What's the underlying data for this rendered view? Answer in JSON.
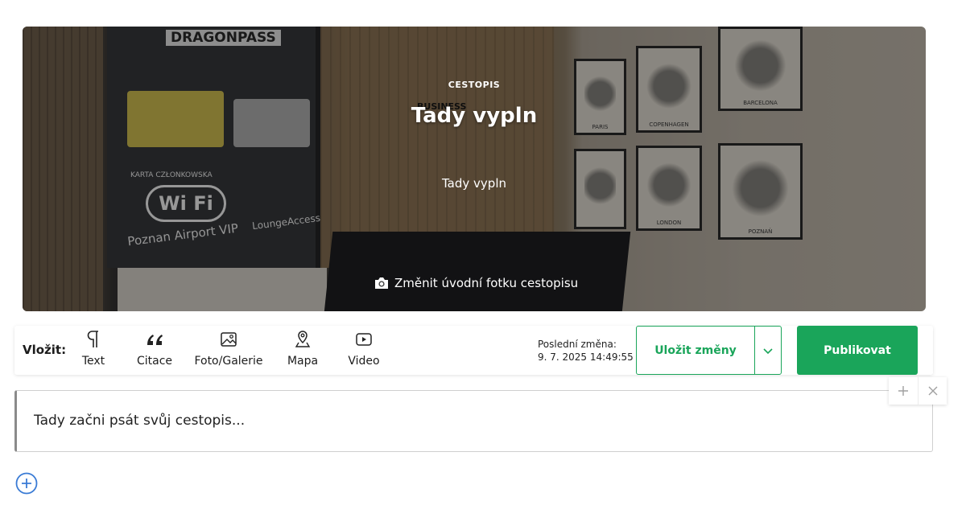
{
  "hero": {
    "label": "CESTOPIS",
    "title": "Tady vypln",
    "subtitle": "Tady vypln",
    "change_photo": "Změnit úvodní fotku cestopisu",
    "photo": {
      "signs": [
        "DRAGONPASS",
        "BUSINESS",
        "Poznan Airport VIP",
        "LoungeAccess",
        "Wi Fi",
        "KARTA CZŁONKOWSKA"
      ],
      "frames": [
        "PARIS",
        "COPENHAGEN",
        "BARCELONA",
        "LONDON",
        "POZNAŃ"
      ]
    }
  },
  "toolbar": {
    "insert_label": "Vložit:",
    "tools": [
      {
        "label": "Text",
        "icon": "pilcrow-icon"
      },
      {
        "label": "Citace",
        "icon": "quote-icon"
      },
      {
        "label": "Foto/Galerie",
        "icon": "image-icon"
      },
      {
        "label": "Mapa",
        "icon": "map-pin-icon"
      },
      {
        "label": "Video",
        "icon": "video-play-icon"
      }
    ],
    "last_change_label": "Poslední změna:",
    "last_change_value": "9. 7. 2025 14:49:55",
    "save_label": "Uložit změny",
    "publish_label": "Publikovat"
  },
  "editor": {
    "placeholder": "Tady začni psát svůj cestopis..."
  },
  "colors": {
    "accent": "#1aa55a",
    "icon_blue": "#3a7bd5"
  }
}
